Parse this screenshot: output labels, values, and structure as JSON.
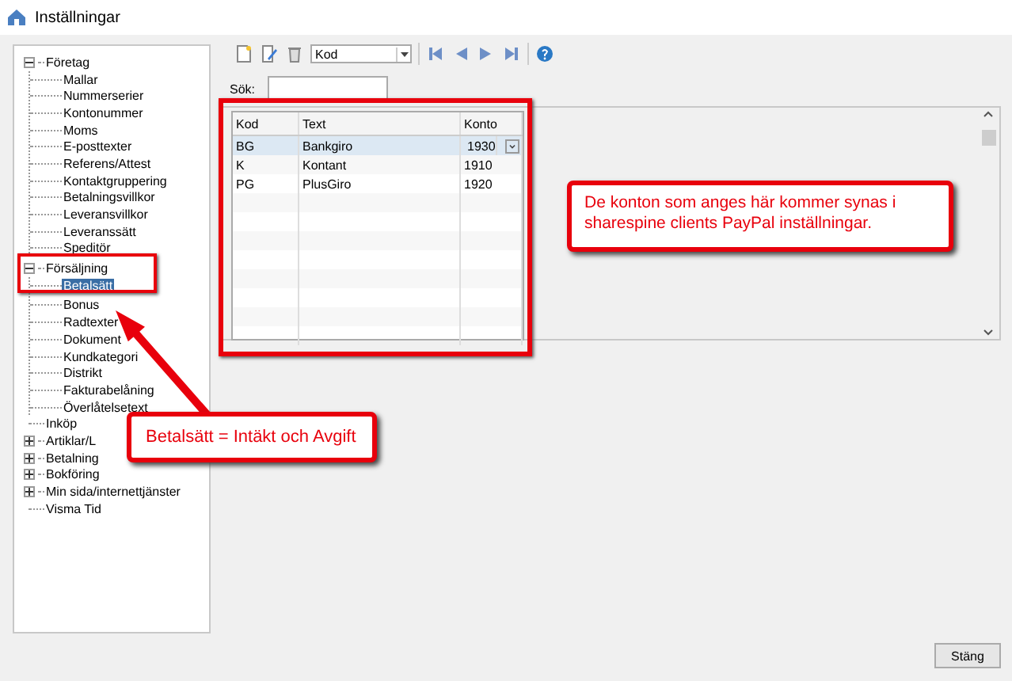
{
  "window": {
    "title": "Inställningar"
  },
  "tree": [
    {
      "label": "Företag",
      "expanded": true,
      "selected": false,
      "children": [
        {
          "label": "Mallar",
          "selected": false
        },
        {
          "label": "Nummerserier",
          "selected": false
        },
        {
          "label": "Kontonummer",
          "selected": false
        },
        {
          "label": "Moms",
          "selected": false
        },
        {
          "label": "E-posttexter",
          "selected": false
        },
        {
          "label": "Referens/Attest",
          "selected": false
        },
        {
          "label": "Kontaktgruppering",
          "selected": false
        },
        {
          "label": "Betalningsvillkor",
          "selected": false
        },
        {
          "label": "Leveransvillkor",
          "selected": false
        },
        {
          "label": "Leveranssätt",
          "selected": false
        },
        {
          "label": "Speditör",
          "selected": false
        }
      ]
    },
    {
      "label": "Försäljning",
      "expanded": true,
      "selected": false,
      "children": [
        {
          "label": "Betalsätt",
          "selected": true
        },
        {
          "label": "Bonus",
          "selected": false
        },
        {
          "label": "Radtexter",
          "selected": false
        },
        {
          "label": "Dokument",
          "selected": false
        },
        {
          "label": "Kundkategori",
          "selected": false
        },
        {
          "label": "Distrikt",
          "selected": false
        },
        {
          "label": "Fakturabelåning",
          "selected": false
        },
        {
          "label": "Överlåtelsetext",
          "selected": false
        }
      ]
    },
    {
      "label": "Inköp",
      "selected": false
    },
    {
      "label": "Artiklar/L",
      "expanded": false,
      "selected": false
    },
    {
      "label": "Betalning",
      "expanded": false,
      "selected": false
    },
    {
      "label": "Bokföring",
      "expanded": false,
      "selected": false
    },
    {
      "label": "Min sida/internettjänster",
      "expanded": false,
      "selected": false
    },
    {
      "label": "Visma Tid",
      "selected": false
    }
  ],
  "toolbar": {
    "sort_field": "Kod"
  },
  "search": {
    "label": "Sök:"
  },
  "table": {
    "columns": [
      "Kod",
      "Text",
      "Konto"
    ],
    "rows": [
      {
        "cells": [
          "BG",
          "Bankgiro",
          "1930"
        ],
        "selected": true
      },
      {
        "cells": [
          "K",
          "Kontant",
          "1910"
        ],
        "selected": false
      },
      {
        "cells": [
          "PG",
          "PlusGiro",
          "1920"
        ],
        "selected": false
      }
    ]
  },
  "annotations": [
    "De konton som anges här kommer synas i sharespine clients PayPal inställningar.",
    "Betalsätt = Intäkt och Avgift"
  ],
  "buttons": [
    "Stäng"
  ]
}
